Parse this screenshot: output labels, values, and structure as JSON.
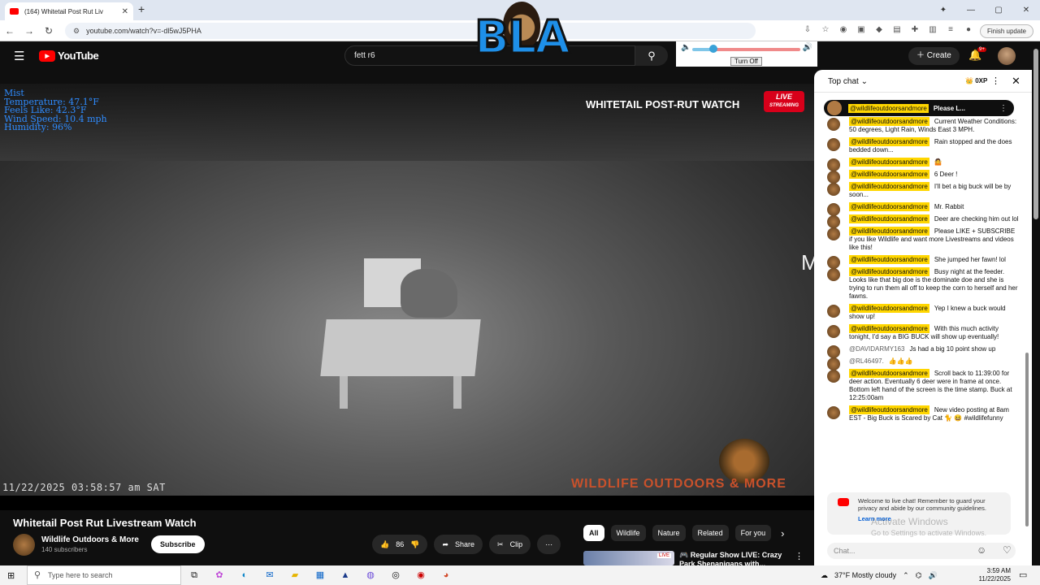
{
  "browser": {
    "tab_title": "(164) Whitetail Post Rut Liv",
    "tab_close": "✕",
    "new_tab": "+",
    "url": "youtube.com/watch?v=-dl5wJ5PHA",
    "finish_update": "Finish update",
    "window_controls": [
      "—",
      "▢",
      "✕"
    ]
  },
  "youtube": {
    "logo_text": "YouTube",
    "search_value": "fett r6",
    "create_label": "Create",
    "notif_badge": "9+"
  },
  "volume_widget": {
    "turn_off_label": "Turn Off",
    "level": 0.2
  },
  "overlay_logo": {
    "text": "BLA"
  },
  "video": {
    "weather": [
      "Mist",
      "Temperature: 47.1°F",
      "Feels Like: 42.3°F",
      "Wind Speed: 10.4 mph",
      "Humidity: 96%"
    ],
    "stream_title": "WHITETAIL POST-RUT WATCH",
    "live_label": "LIVE",
    "live_sub": "STREAMING",
    "timestamp": "11/22/2025 03:58:57 am SAT",
    "watermark": "WILDLIFE OUTDOORS & MORE",
    "cut_glyph": "M"
  },
  "below_video": {
    "title": "Whitetail Post Rut Livestream Watch",
    "channel_name": "Wildlife Outdoors & More",
    "subscribers": "140 subscribers",
    "subscribe_label": "Subscribe",
    "like_count": "86",
    "share_label": "Share",
    "clip_label": "Clip",
    "chips": [
      "All",
      "Wildlife",
      "Nature",
      "Related",
      "For you"
    ],
    "rec_title": "🎮 Regular Show LIVE: Crazy Park Shenanigans with...",
    "rec_badge": "LIVE"
  },
  "chat": {
    "header": "Top chat",
    "xp": "0XP",
    "pinned_author": "@wildlifeoutdoorsandmore",
    "pinned_text": "Please L...",
    "messages": [
      {
        "author": "@wildlifeoutdoorsandmore",
        "text": "Current Weather Conditions: 50 degrees, Light Rain, Winds East 3 MPH.",
        "owner": true
      },
      {
        "author": "@wildlifeoutdoorsandmore",
        "text": "Rain stopped and the does bedded down...",
        "owner": true
      },
      {
        "author": "@wildlifeoutdoorsandmore",
        "text": "🤷",
        "owner": true
      },
      {
        "author": "@wildlifeoutdoorsandmore",
        "text": "6 Deer !",
        "owner": true
      },
      {
        "author": "@wildlifeoutdoorsandmore",
        "text": "I'll bet a big buck will be by soon...",
        "owner": true
      },
      {
        "author": "@wildlifeoutdoorsandmore",
        "text": "Mr. Rabbit",
        "owner": true
      },
      {
        "author": "@wildlifeoutdoorsandmore",
        "text": "Deer are checking him out lol",
        "owner": true
      },
      {
        "author": "@wildlifeoutdoorsandmore",
        "text": "Please LIKE + SUBSCRIBE if you like Wildlife and want more Livestreams and videos like this!",
        "owner": true
      },
      {
        "author": "@wildlifeoutdoorsandmore",
        "text": "She jumped her fawn! lol",
        "owner": true
      },
      {
        "author": "@wildlifeoutdoorsandmore",
        "text": "Busy night at the feeder. Looks like that big doe is the dominate doe and she is trying to run them all off to keep the corn to herself and her fawns.",
        "owner": true
      },
      {
        "author": "@wildlifeoutdoorsandmore",
        "text": "Yep I knew a buck would show up!",
        "owner": true
      },
      {
        "author": "@wildlifeoutdoorsandmore",
        "text": "With this much activity tonight, I'd say a BIG BUCK will show up eventually!",
        "owner": true
      },
      {
        "author": "@DAVIDARMY163",
        "text": "Js had a big 10 point show up",
        "owner": false
      },
      {
        "author": "@RL46497.",
        "text": "👍👍👍",
        "owner": false
      },
      {
        "author": "@wildlifeoutdoorsandmore",
        "text": "Scroll back to 11:39:00 for deer action. Eventually 6 deer were in frame at once. Bottom left hand of the screen is the time stamp. Buck at 12:25:00am",
        "owner": true
      },
      {
        "author": "@wildlifeoutdoorsandmore",
        "text": "New video posting at 8am EST - Big Buck is Scared by Cat 🐈 😆 #wildlifefunny",
        "owner": true
      }
    ],
    "welcome_text": "Welcome to live chat! Remember to guard your privacy and abide by our community guidelines.",
    "learn_more": "Learn more",
    "activate_title": "Activate Windows",
    "activate_sub": "Go to Settings to activate Windows.",
    "input_placeholder": "Chat..."
  },
  "taskbar": {
    "search_placeholder": "Type here to search",
    "weather": "37°F  Mostly cloudy",
    "time": "3:59 AM",
    "date": "11/22/2025"
  }
}
